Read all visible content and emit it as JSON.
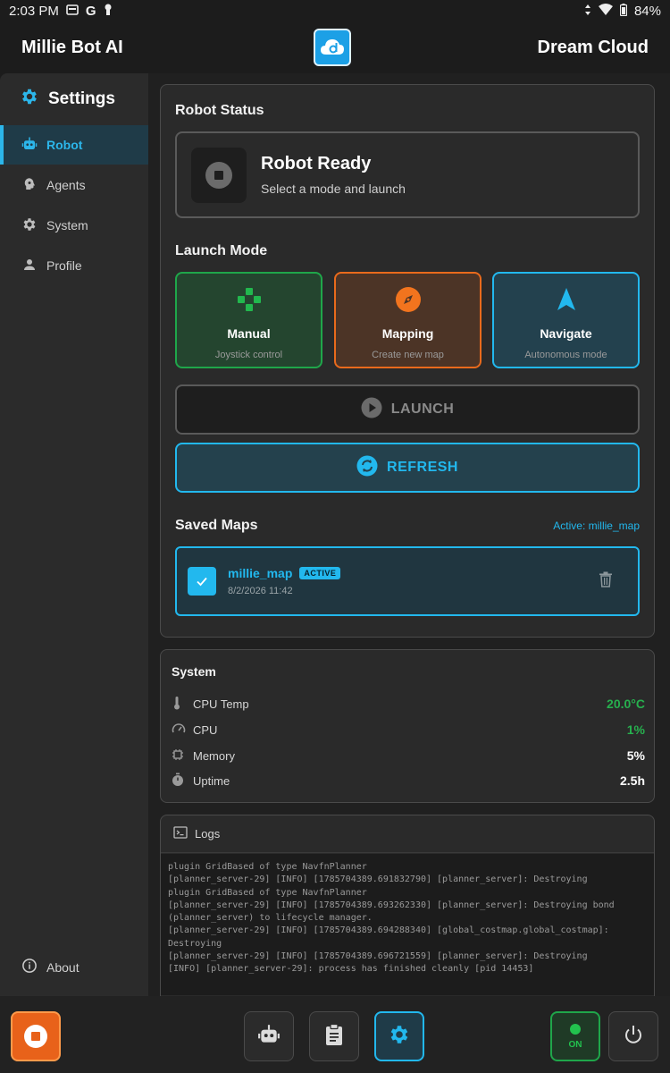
{
  "statusbar": {
    "time": "2:03 PM",
    "battery": "84%"
  },
  "appbar": {
    "left_title": "Millie Bot AI",
    "right_title": "Dream Cloud"
  },
  "sidebar": {
    "header": "Settings",
    "items": [
      {
        "label": "Robot",
        "icon": "robot-icon",
        "active": true
      },
      {
        "label": "Agents",
        "icon": "brain-icon",
        "active": false
      },
      {
        "label": "System",
        "icon": "gear-icon",
        "active": false
      },
      {
        "label": "Profile",
        "icon": "person-icon",
        "active": false
      }
    ],
    "about": "About"
  },
  "robot_status": {
    "section_title": "Robot Status",
    "state": "Robot Ready",
    "hint": "Select a mode and launch"
  },
  "launch_mode": {
    "section_title": "Launch Mode",
    "modes": [
      {
        "label": "Manual",
        "sub": "Joystick control",
        "color": "#1fa64a"
      },
      {
        "label": "Mapping",
        "sub": "Create new map",
        "color": "#e96a1c"
      },
      {
        "label": "Navigate",
        "sub": "Autonomous mode",
        "color": "#22b8ee"
      }
    ],
    "launch_label": "LAUNCH",
    "refresh_label": "REFRESH"
  },
  "saved_maps": {
    "section_title": "Saved Maps",
    "active_note": "Active: millie_map",
    "items": [
      {
        "name": "millie_map",
        "badge": "ACTIVE",
        "date": "8/2/2026 11:42"
      }
    ]
  },
  "system": {
    "title": "System",
    "rows": [
      {
        "label": "CPU Temp",
        "value": "20.0°C",
        "color": "#27b04e"
      },
      {
        "label": "CPU",
        "value": "1%",
        "color": "#27b04e"
      },
      {
        "label": "Memory",
        "value": "5%",
        "color": "#ffffff"
      },
      {
        "label": "Uptime",
        "value": "2.5h",
        "color": "#ffffff"
      }
    ]
  },
  "logs": {
    "title": "Logs",
    "lines": [
      "plugin GridBased of type NavfnPlanner",
      "[planner_server-29] [INFO] [1785704389.691832790] [planner_server]: Destroying",
      "plugin GridBased of type NavfnPlanner",
      "[planner_server-29] [INFO] [1785704389.693262330] [planner_server]: Destroying bond",
      "(planner_server) to lifecycle manager.",
      "[planner_server-29] [INFO] [1785704389.694288340] [global_costmap.global_costmap]:",
      "Destroying",
      "[planner_server-29] [INFO] [1785704389.696721559] [planner_server]: Destroying",
      "[INFO] [planner_server-29]: process has finished cleanly [pid 14453]"
    ]
  },
  "bottombar": {
    "power_state": "ON"
  },
  "colors": {
    "accent": "#22b8ee",
    "orange": "#e96a1c",
    "green": "#1fa64a"
  }
}
